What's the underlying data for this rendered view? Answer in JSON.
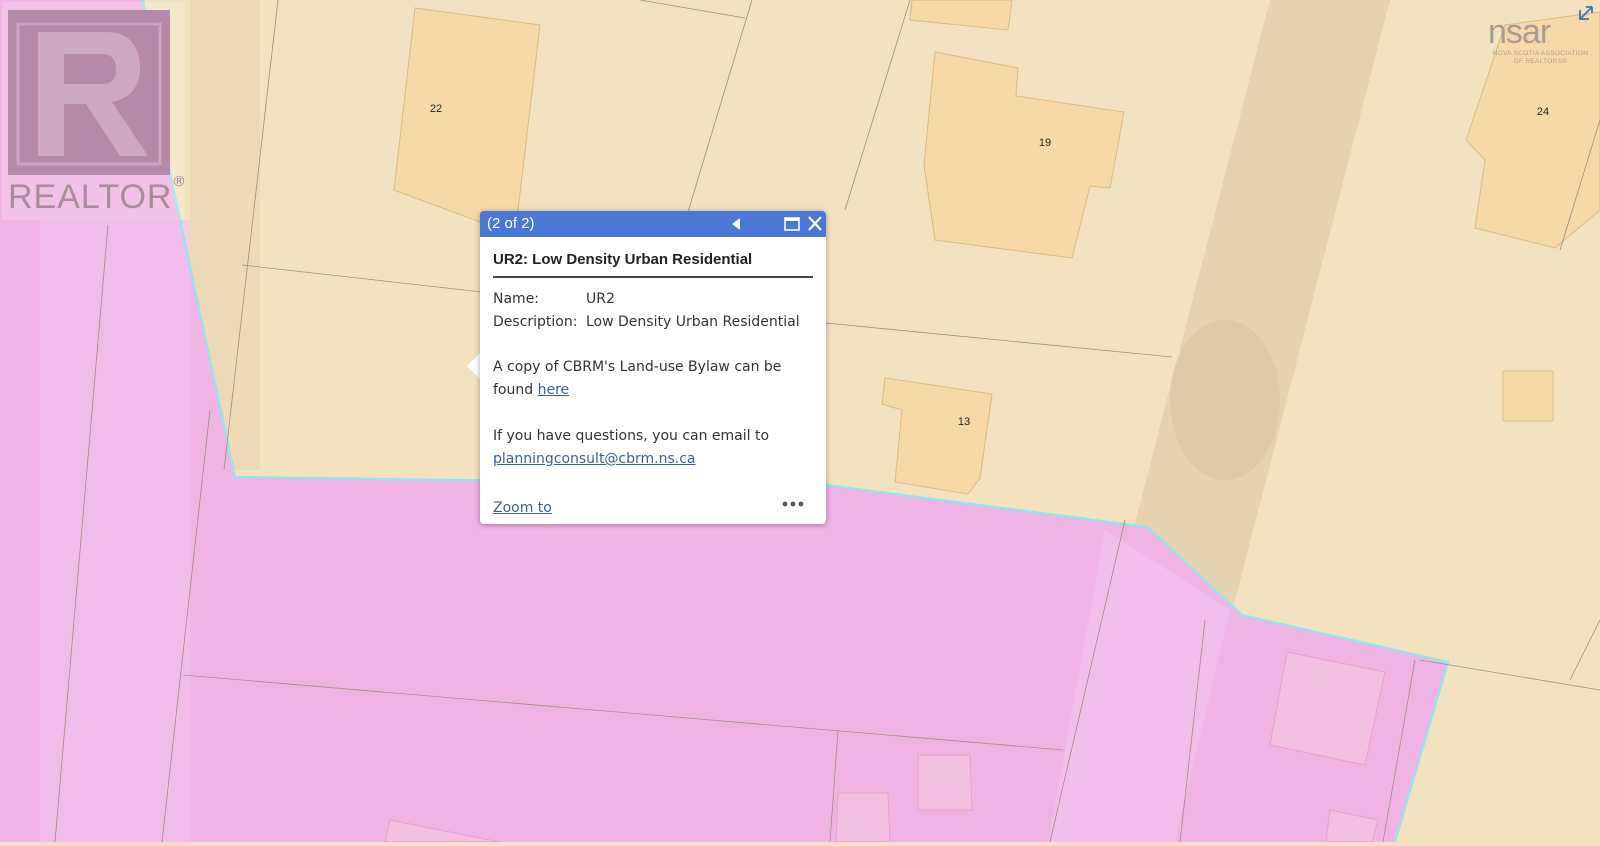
{
  "map": {
    "parcel_labels": [
      "22",
      "19",
      "24",
      "13"
    ],
    "colors": {
      "residential": "#f2e2bf",
      "building": "#f5d9a8",
      "zone_pink": "#efb4e4",
      "zone_boundary": "#8ee6ee",
      "parcel_line": "#9b8f80"
    }
  },
  "watermarks": {
    "realtor_word": "REALTOR",
    "realtor_reg": "®",
    "nsar_main": "nsar",
    "nsar_sub_1": "NOVA SCOTIA ASSOCIATION",
    "nsar_sub_2": "OF REALTORS®"
  },
  "popup": {
    "counter": "(2 of 2)",
    "title": "UR2: Low Density Urban Residential",
    "fields": [
      {
        "label": "Name:",
        "value": "UR2"
      },
      {
        "label": "Description:",
        "value": "Low Density Urban Residential"
      }
    ],
    "bylaw_text_1": "A copy of CBRM's Land-use Bylaw can be",
    "bylaw_text_2": "found ",
    "bylaw_link": "here",
    "questions_text": "If you have questions, you can email to",
    "email_link": "planningconsult@cbrm.ns.ca",
    "zoom_to": "Zoom to",
    "header_color": "#4a76d6"
  }
}
